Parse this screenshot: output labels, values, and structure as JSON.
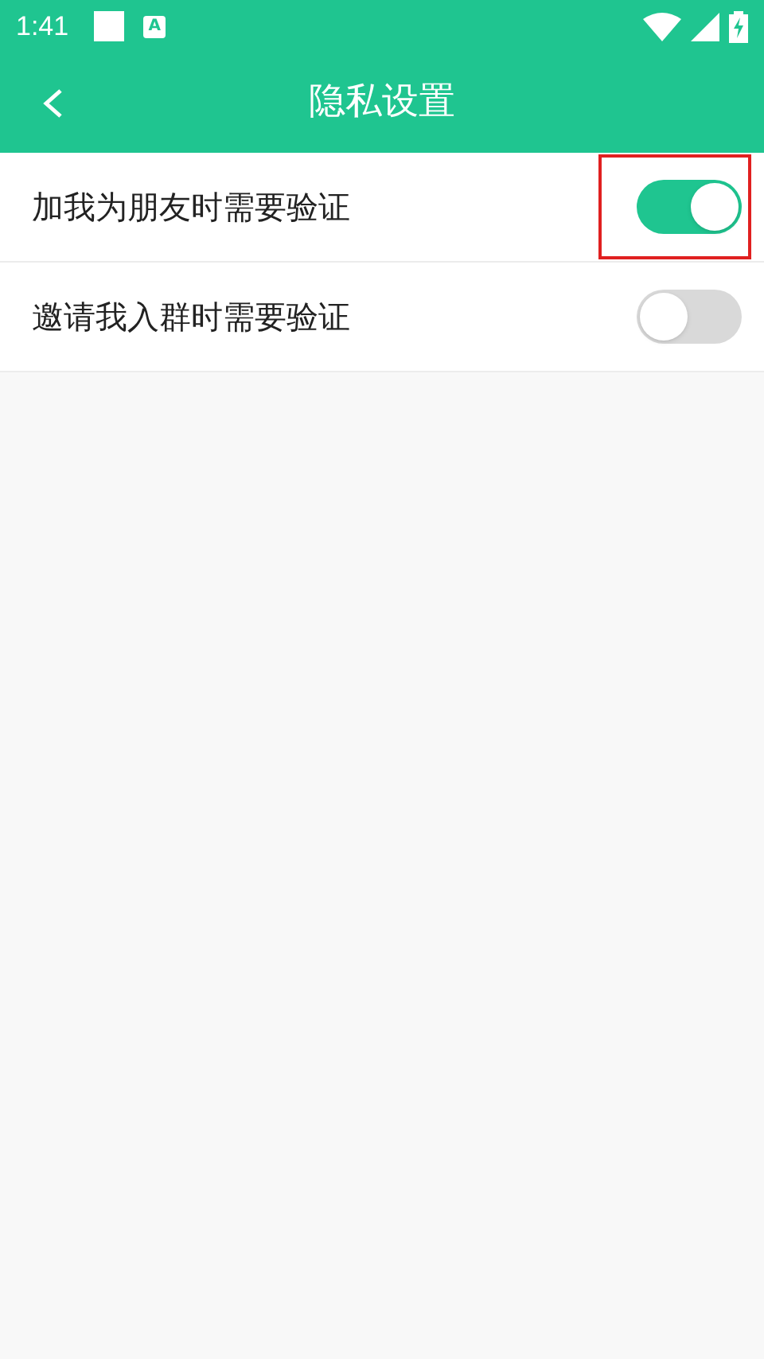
{
  "status_bar": {
    "time": "1:41",
    "notification_icons": [
      {
        "kind": "square"
      },
      {
        "kind": "letter",
        "glyph": "A"
      }
    ]
  },
  "header": {
    "title": "隐私设置"
  },
  "settings": [
    {
      "label": "加我为朋友时需要验证",
      "on": true,
      "highlighted": true
    },
    {
      "label": "邀请我入群时需要验证",
      "on": false,
      "highlighted": false
    }
  ]
}
